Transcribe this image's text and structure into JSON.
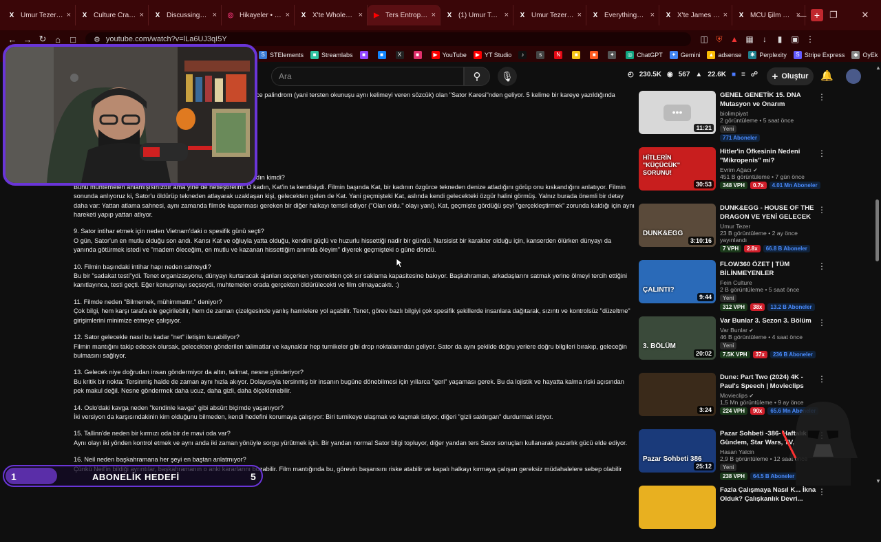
{
  "tabs": [
    {
      "label": "Umur Tezer (@Umu",
      "icon": "x-icon"
    },
    {
      "label": "Culture Crave 🍿 (@",
      "icon": "x-icon"
    },
    {
      "label": "DiscussingFilm (@D",
      "icon": "x-icon"
    },
    {
      "label": "Hikayeler • Instagra",
      "icon": "instagram-icon"
    },
    {
      "label": "X'te Wholesome Sid",
      "icon": "x-icon"
    },
    {
      "label": "Ters Entropi: Te",
      "icon": "youtube-icon",
      "active": true
    },
    {
      "label": "(1) Umur Tezer (@U",
      "icon": "x-icon"
    },
    {
      "label": "Umur Tezer (@Umu",
      "icon": "x-icon"
    },
    {
      "label": "Everything_DCU (@",
      "icon": "x-icon"
    },
    {
      "label": "X'te James Gunn: \"",
      "icon": "x-icon"
    },
    {
      "label": "MCU Film News (@",
      "icon": "x-icon"
    }
  ],
  "url": "youtube.com/watch?v=lLa6UJ3qI5Y",
  "bookmarks": [
    {
      "label": "STElements",
      "color": "#3a7bd5",
      "glyph": "S"
    },
    {
      "label": "Streamlabs",
      "color": "#31c3a2",
      "glyph": "■"
    },
    {
      "label": "",
      "color": "#9146ff",
      "glyph": "■"
    },
    {
      "label": "",
      "color": "#1185fe",
      "glyph": "■"
    },
    {
      "label": "",
      "color": "#222222",
      "glyph": "X"
    },
    {
      "label": "",
      "color": "#e1306c",
      "glyph": "■"
    },
    {
      "label": "YouTube",
      "color": "#ff0000",
      "glyph": "▶"
    },
    {
      "label": "YT Studio",
      "color": "#ff0000",
      "glyph": "▶"
    },
    {
      "label": "",
      "color": "#111111",
      "glyph": "♪"
    },
    {
      "label": "",
      "color": "#444444",
      "glyph": "s"
    },
    {
      "label": "",
      "color": "#e50914",
      "glyph": "N"
    },
    {
      "label": "",
      "color": "#f5c518",
      "glyph": "■"
    },
    {
      "label": "",
      "color": "#ff5a1f",
      "glyph": "■"
    },
    {
      "label": "",
      "color": "#555555",
      "glyph": "✦"
    },
    {
      "label": "ChatGPT",
      "color": "#10a37f",
      "glyph": "◎"
    },
    {
      "label": "Gemini",
      "color": "#4285f4",
      "glyph": "✦"
    },
    {
      "label": "adsense",
      "color": "#fbbc04",
      "glyph": "▲"
    },
    {
      "label": "Perplexity",
      "color": "#20808d",
      "glyph": "✱"
    },
    {
      "label": "Stripe Express",
      "color": "#635bff",
      "glyph": "S"
    },
    {
      "label": "OyEk",
      "color": "#888888",
      "glyph": "◆"
    }
  ],
  "search": {
    "placeholder": "Ara"
  },
  "stats": {
    "views": "230.5K",
    "watching": "567",
    "likes": "22.6K"
  },
  "create_label": "Oluştur",
  "article": {
    "intro": "ce palindrom (yani tersten okunuşu aynı kelimeyi veren sözcük) olan \"Sator Karesi\"nden geliyor. 5 kelime bir kareye yazıldığında",
    "partial_q": "dın kimdi?",
    "partial_a": "Bunu muhtemelen anlamışısınızdır ama yine de netleştirelim: O kadın, Kat'in ta kendisiydi. Filmin başında Kat, bir kadının özgürce tekneden denize atladığını görüp onu kıskandığını anlatıyor. Filmin sonunda anlıyoruz ki, Sator'u öldürüp tekneden atlayarak uzaklaşan kişi, gelecekten gelen de Kat. Yani geçmişteki Kat, aslında kendi gelecekteki özgür halini görmüş. Yalnız burada önemli bir detay daha var: Yattan atlama sahnesi, aynı zamanda filmde kapanması gereken bir diğer halkayı temsil ediyor (\"Olan oldu.\" olayı yani). Kat, geçmişte gördüğü şeyi \"gerçekleştirmek\" zorunda kaldığı için aynı hareketi yapıp yattan atlıyor.",
    "items": [
      {
        "q": "9. Sator intihar etmek için neden Vietnam'daki o spesifik günü seçti?",
        "a": "O gün, Sator'un en mutlu olduğu son andı. Karısı Kat ve oğluyla yatta olduğu, kendini güçlü ve huzurlu hissettiği nadir bir gündü. Narsisist bir karakter olduğu için, kanserden ölürken dünyayı da yanında götürmek istedi ve \"madem öleceğim, en mutlu ve kazanan hissettiğim anımda öleyim\" diyerek geçmişteki o güne döndü."
      },
      {
        "q": "10. Filmin başındaki intihar hapı neden sahteydi?",
        "a": "Bu bir \"sadakat testi\"ydi. Tenet organizasyonu, dünyayı kurtaracak ajanları seçerken yetenekten çok sır saklama kapasitesine bakıyor. Başkahraman, arkadaşlarını satmak yerine ölmeyi tercih ettiğini kanıtlayınca, testi geçti. Eğer konuşmayı seçseydi, muhtemelen orada gerçekten öldürülecekti ve film olmayacaktı. :)"
      },
      {
        "q": "11. Filmde neden \"Bilmemek, mühimmattır.\" deniyor?",
        "a": "Çok bilgi, hem karşı tarafa ele geçirilebilir, hem de zaman çizelgesinde yanlış hamlelere yol açabilir. Tenet, görev bazlı bilgiyi çok spesifik şekillerde insanlara dağıtarak, sızıntı ve kontrolsüz \"düzeltme\" girişimlerini minimize etmeye çalışıyor."
      },
      {
        "q": "12. Sator gelecekle nasıl bu kadar \"net\" iletişim kurabiliyor?",
        "a": "Filmin mantığını takip edecek olursak, gelecekten gönderilen talimatlar ve kaynaklar hep turnikeler gibi drop noktalarından geliyor. Sator da aynı şekilde doğru yerlere doğru bilgileri bırakıp, geleceğin bulmasını sağlıyor."
      },
      {
        "q": "13. Gelecek niye doğrudan insan göndermiyor da altın, talimat, nesne gönderiyor?",
        "a": "Bu kritik bir nokta: Tersinmiş halde de zaman aynı hızla akıyor. Dolayısıyla tersinmiş bir insanın bugüne dönebilmesi için yıllarca \"geri\" yaşaması gerek. Bu da lojistik ve hayatta kalma riski açısından pek makul değil. Nesne göndermek daha ucuz, daha gizli, daha ölçeklenebilir."
      },
      {
        "q": "14. Oslo'daki kavga neden \"kendinle kavga\" gibi absürt biçimde yaşanıyor?",
        "a": "İki versiyon da karşısındakinin kim olduğunu bilmeden, kendi hedefini korumaya çalışıyor: Biri turnikeye ulaşmak ve kaçmak istiyor, diğeri \"gizli saldırgan\" durdurmak istiyor."
      },
      {
        "q": "15. Tallinn'de neden bir kırmızı oda bir de mavi oda var?",
        "a": "Aynı olayı iki yönden kontrol etmek ve aynı anda iki zaman yönüyle sorgu yürütmek için. Bir yandan normal Sator bilgi topluyor, diğer yandan ters Sator sonuçları kullanarak pazarlık gücü elde ediyor."
      },
      {
        "q": "16. Neil neden başkahramana her şeyi en baştan anlatmıyor?",
        "a": "Çünkü Neil'in bildiği ayrıntılar, başkahramanın o anki kararlarını bozabilir. Film mantığında bu, görevin başarısını riske atabilir ve kapalı halkayı kırmaya çalışan gereksiz müdahalelere sebep olabilir"
      }
    ]
  },
  "videos": [
    {
      "title": "GENEL GENETİK 15. DNA Mutasyon ve Onarım",
      "channel": "biolimpiyat",
      "meta": "2 görüntüleme • 5 saat önce",
      "duration": "11:21",
      "badges": [
        "Yeni",
        "771 Aboneler"
      ],
      "thumb_color": "#d8d8d8",
      "verified": false
    },
    {
      "title": "Hitler'in Öfkesinin Nedeni \"Mikropenis\" mi?",
      "channel": "Evrim Ağacı",
      "meta": "451 B görüntüleme • 7 gün önce",
      "duration": "30:53",
      "badges": [
        "348 VPH",
        "0.7x",
        "4.01 Mn Aboneler"
      ],
      "thumb_color": "#c81e1e",
      "thumb_text": "HİTLERİN \"KÜÇÜCÜK\" SORUNU!",
      "verified": true
    },
    {
      "title": "DUNK&EGG - HOUSE OF THE DRAGON VE YENİ GELECEK ...",
      "channel": "Umur Tezer",
      "meta": "23 B görüntüleme • 2 ay önce yayınlandı",
      "duration": "3:10:16",
      "badges": [
        "7 VPH",
        "2.8x",
        "66.8 B Aboneler"
      ],
      "thumb_color": "#5a4a3a",
      "thumb_text": "DUNK&EGG",
      "verified": false
    },
    {
      "title": "FLOW360 ÖZET | TÜM BİLİNMEYENLER",
      "channel": "Fein Culture",
      "meta": "2 B görüntüleme • 5 saat önce",
      "duration": "9:44",
      "badges": [
        "Yeni",
        "312 VPH",
        "38x",
        "13.2 B Aboneler"
      ],
      "thumb_color": "#2a6ab8",
      "thumb_text": "ÇALINTI?",
      "verified": false
    },
    {
      "title": "Var Bunlar 3. Sezon 3. Bölüm",
      "channel": "Var Bunlar",
      "meta": "46 B görüntüleme • 4 saat önce",
      "duration": "20:02",
      "badges": [
        "Yeni",
        "7.5K VPH",
        "37x",
        "236 B Aboneler"
      ],
      "thumb_color": "#3a4a3a",
      "thumb_text": "3. BÖLÜM",
      "verified": true
    },
    {
      "title": "Dune: Part Two (2024) 4K - Paul's Speech | Movieclips",
      "channel": "Movieclips",
      "meta": "1,5 Mn görüntüleme • 9 ay önce",
      "duration": "3:24",
      "badges": [
        "224 VPH",
        "90x",
        "65.6 Mn Aboneler"
      ],
      "thumb_color": "#3a2a1a",
      "verified": true
    },
    {
      "title": "Pazar Sohbeti -386- Haftalık Gündem, Star Wars, TV, Sinem...",
      "channel": "Hasan Yalcin",
      "meta": "2,9 B görüntüleme • 12 saat önce",
      "duration": "25:12",
      "badges": [
        "Yeni",
        "238 VPH",
        "64.5 B Aboneler"
      ],
      "thumb_color": "#1a3a7a",
      "thumb_text": "Pazar Sohbeti 386",
      "verified": false
    },
    {
      "title": "Fazla Çalışmaya Nasıl K... İkna Olduk? Çalışkanlık Devri...",
      "channel": "",
      "meta": "",
      "duration": "",
      "badges": [],
      "thumb_color": "#e8b020",
      "verified": false
    }
  ],
  "subgoal": {
    "current": "1",
    "label": "ABONELİK HEDEFİ",
    "target": "5",
    "progress": 0.2
  }
}
